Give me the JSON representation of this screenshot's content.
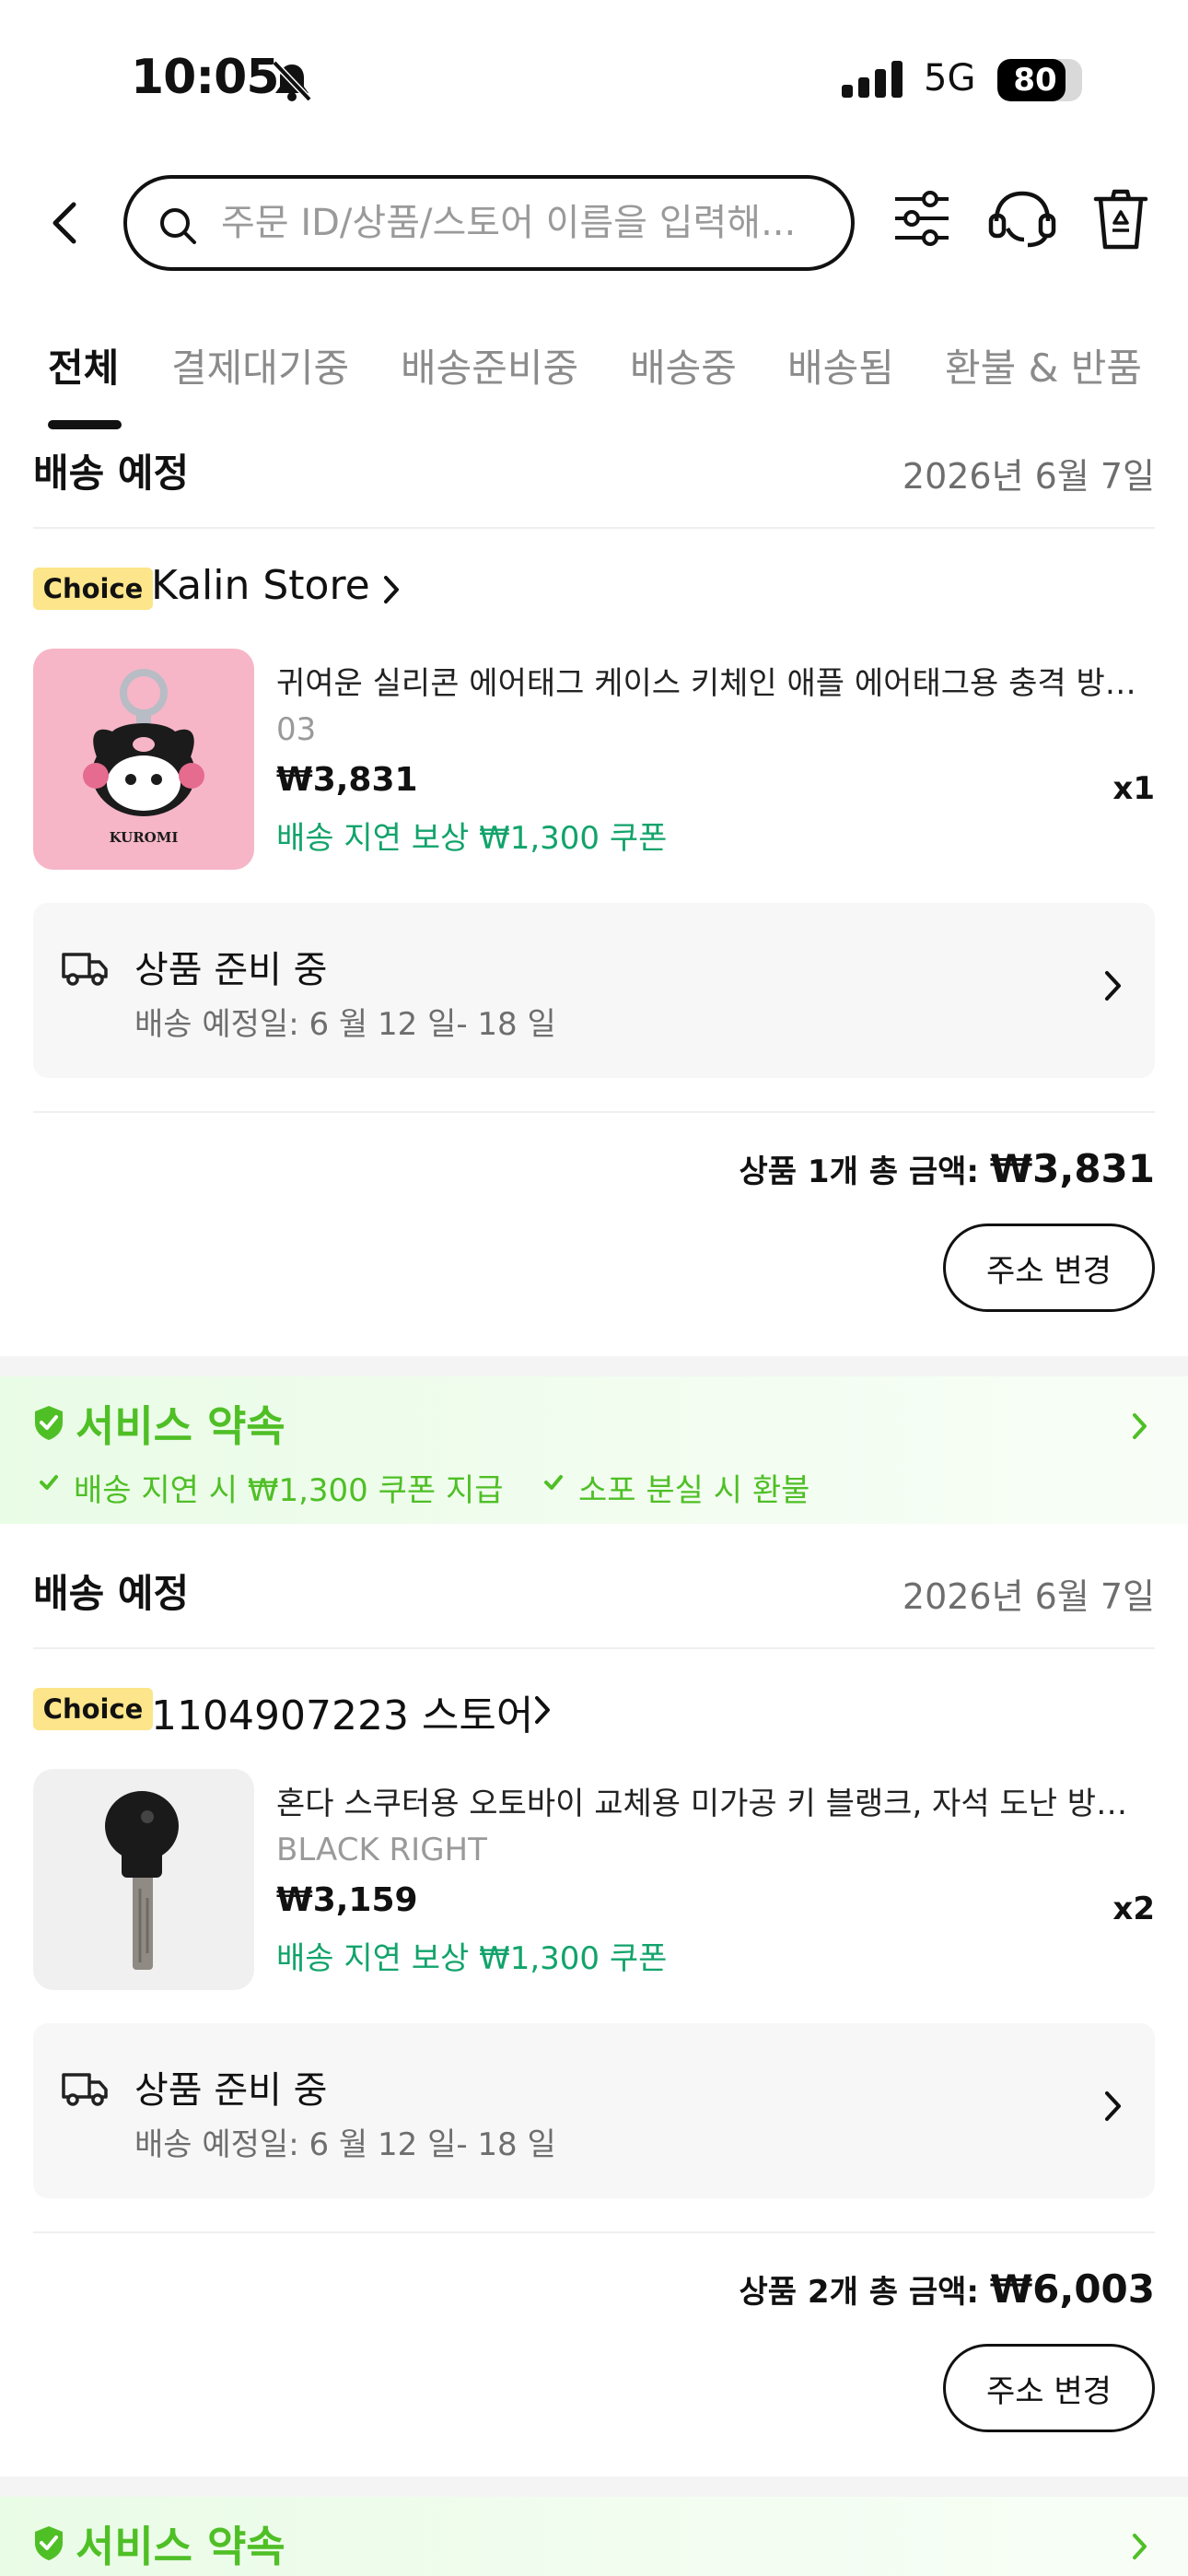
{
  "status_bar": {
    "time": "10:05",
    "network": "5G",
    "battery_level": 80,
    "battery_text": "80"
  },
  "header": {
    "search_placeholder": "주문 ID/상품/스토어 이름을 입력해..."
  },
  "tabs": [
    "전체",
    "결제대기중",
    "배송준비중",
    "배송중",
    "배송됨",
    "환불 & 반품"
  ],
  "orders": [
    {
      "heading": "배송 예정",
      "date": "2026년 6월 7일",
      "badge": "Choice",
      "store": "Kalin Store",
      "product_title": "귀여운 실리콘 에어태그 케이스 키체인 애플 에어태그용 충격 방지...",
      "variant": "03",
      "price": "₩3,831",
      "coupon": "배송 지연 보상 ₩1,300 쿠폰",
      "qty": "x1",
      "status": "상품 준비 중",
      "eta": "배송 예정일: 6 월 12 일- 18 일",
      "total_label": "상품 1개 총 금액: ",
      "total_amount": "₩3,831",
      "address_button": "주소 변경",
      "image_text": "KUROMI"
    },
    {
      "heading": "배송 예정",
      "date": "2026년 6월 7일",
      "badge": "Choice",
      "store": "1104907223 스토어",
      "product_title": "혼다 스쿠터용 오토바이 교체용 미가공 키 블랭크, 자석 도난 방지...",
      "variant": "BLACK RIGHT",
      "price": "₩3,159",
      "coupon": "배송 지연 보상 ₩1,300 쿠폰",
      "qty": "x2",
      "status": "상품 준비 중",
      "eta": "배송 예정일: 6 월 12 일- 18 일",
      "total_label": "상품 2개 총 금액: ",
      "total_amount": "₩6,003",
      "address_button": "주소 변경"
    }
  ],
  "service_promise": {
    "title": "서비스 약속",
    "items": [
      "배송 지연 시 ₩1,300 쿠폰 지급",
      "소포 분실 시 환불"
    ]
  },
  "colors": {
    "accent_green": "#4fbf26",
    "coupon_green": "#12a36b",
    "choice_yellow": "#fce58a",
    "kuromi_pink": "#f6b6c8"
  }
}
